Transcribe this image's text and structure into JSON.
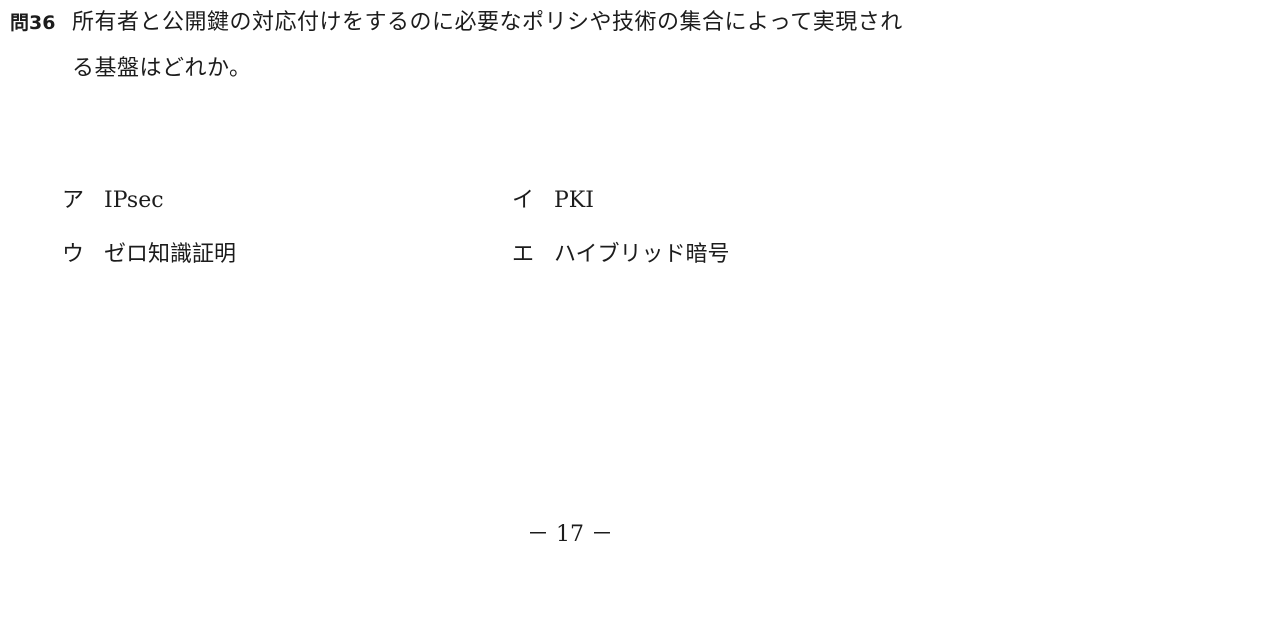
{
  "question": {
    "number": "問36",
    "text_line1": "所有者と公開鍵の対応付けをするのに必要なポリシや技術の集合によって実現され",
    "text_line2": "る基盤はどれか。"
  },
  "options": [
    {
      "mark": "ア",
      "text": "IPsec"
    },
    {
      "mark": "イ",
      "text": "PKI"
    },
    {
      "mark": "ウ",
      "text": "ゼロ知識証明"
    },
    {
      "mark": "エ",
      "text": "ハイブリッド暗号"
    }
  ],
  "page_number": "－ 17 －"
}
